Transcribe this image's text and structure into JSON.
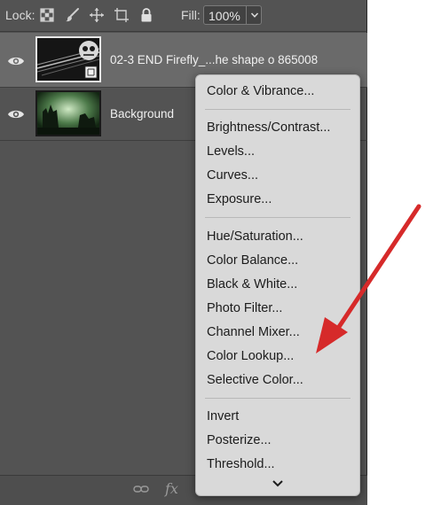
{
  "lockbar": {
    "lock_label": "Lock:",
    "fill_label": "Fill:",
    "fill_value": "100%"
  },
  "layers": [
    {
      "name": "02-3 END Firefly_...he shape o 865008",
      "selected": true
    },
    {
      "name": "Background",
      "selected": false
    }
  ],
  "menu": {
    "groups": [
      [
        "Color & Vibrance..."
      ],
      [
        "Brightness/Contrast...",
        "Levels...",
        "Curves...",
        "Exposure..."
      ],
      [
        "Hue/Saturation...",
        "Color Balance...",
        "Black & White...",
        "Photo Filter...",
        "Channel Mixer...",
        "Color Lookup...",
        "Selective Color..."
      ],
      [
        "Invert",
        "Posterize...",
        "Threshold..."
      ]
    ]
  },
  "bottombar": {
    "fx_label": "fx"
  },
  "colors": {
    "panel": "#535353",
    "menu": "#d9d9d9",
    "arrow": "#d62a2a"
  }
}
